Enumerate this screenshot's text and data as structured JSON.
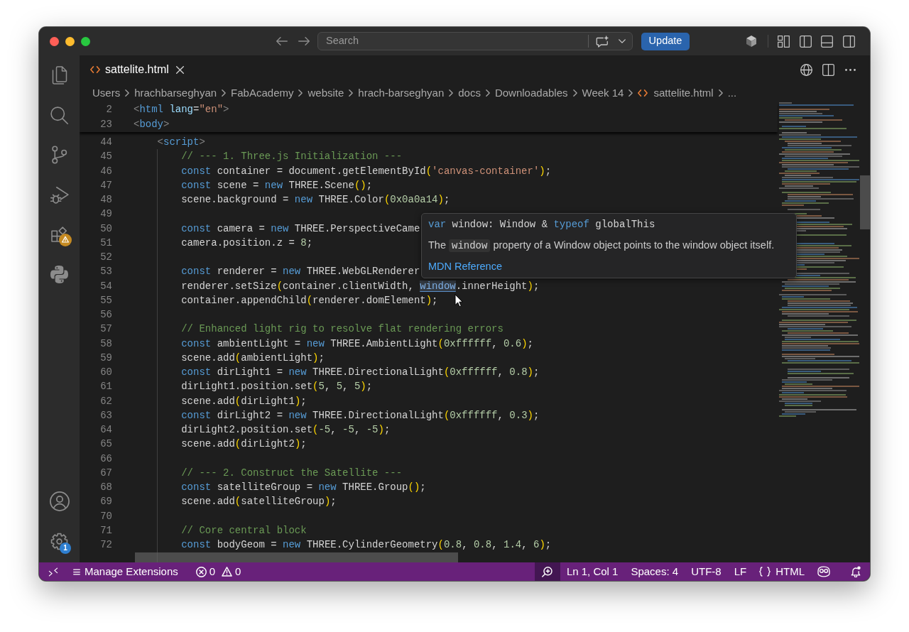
{
  "title_bar": {
    "search": {
      "placeholder": "Search"
    },
    "update_button": {
      "label": "Update"
    }
  },
  "activity_bar": {
    "top": [
      {
        "kind": "explorer"
      },
      {
        "kind": "search"
      },
      {
        "kind": "source_control"
      },
      {
        "kind": "run_debug"
      },
      {
        "kind": "extensions",
        "badge": {
          "kind": "warning"
        }
      },
      {
        "kind": "python"
      }
    ],
    "bottom": [
      {
        "kind": "accounts"
      },
      {
        "kind": "manage",
        "badge": {
          "kind": "count",
          "text": "1"
        }
      }
    ]
  },
  "tabs": [
    {
      "label": "sattelite.html",
      "selected": true
    }
  ],
  "breadcrumbs": [
    {
      "kind": "folder",
      "label": "Users"
    },
    {
      "kind": "folder",
      "label": "hrachbarseghyan"
    },
    {
      "kind": "folder",
      "label": "FabAcademy"
    },
    {
      "kind": "folder",
      "label": "website"
    },
    {
      "kind": "folder",
      "label": "hrach-barseghyan"
    },
    {
      "kind": "folder",
      "label": "docs"
    },
    {
      "kind": "folder",
      "label": "Downloadables"
    },
    {
      "kind": "folder",
      "label": "Week 14"
    },
    {
      "kind": "file",
      "label": "sattelite.html"
    },
    {
      "kind": "more",
      "label": "..."
    }
  ],
  "editor": {
    "sticky_lines": [
      {
        "number": "2",
        "tokens": [
          {
            "kind": "tag_bracket",
            "text": "<"
          },
          {
            "kind": "tag",
            "text": "html"
          },
          {
            "kind": "attribute",
            "text": " lang"
          },
          {
            "kind": "plain",
            "text": "="
          },
          {
            "kind": "string",
            "text": "\"en\""
          },
          {
            "kind": "tag_bracket",
            "text": ">"
          }
        ]
      },
      {
        "number": "23",
        "tokens": [
          {
            "kind": "tag_bracket",
            "text": "<"
          },
          {
            "kind": "tag",
            "text": "body"
          },
          {
            "kind": "tag_bracket",
            "text": ">"
          }
        ]
      }
    ],
    "lines": [
      {
        "number": "44",
        "tokens": [
          {
            "kind": "tag_bracket",
            "text": "    <"
          },
          {
            "kind": "tag",
            "text": "script"
          },
          {
            "kind": "tag_bracket",
            "text": ">"
          }
        ]
      },
      {
        "number": "45",
        "tokens": [
          {
            "kind": "comment",
            "text": "        // --- 1. Three.js Initialization ---"
          }
        ]
      },
      {
        "number": "46",
        "tokens": [
          {
            "kind": "keyword",
            "text": "        const"
          },
          {
            "kind": "plain",
            "text": " container = document.getElementById"
          },
          {
            "kind": "bracket",
            "text": "("
          },
          {
            "kind": "string",
            "text": "'canvas-container'"
          },
          {
            "kind": "bracket",
            "text": ")"
          },
          {
            "kind": "plain",
            "text": ";"
          }
        ]
      },
      {
        "number": "47",
        "tokens": [
          {
            "kind": "keyword",
            "text": "        const"
          },
          {
            "kind": "plain",
            "text": " scene = "
          },
          {
            "kind": "keyword",
            "text": "new"
          },
          {
            "kind": "plain",
            "text": " THREE.Scene"
          },
          {
            "kind": "bracket",
            "text": "()"
          },
          {
            "kind": "plain",
            "text": ";"
          }
        ]
      },
      {
        "number": "48",
        "tokens": [
          {
            "kind": "plain",
            "text": "        scene.background = "
          },
          {
            "kind": "keyword",
            "text": "new"
          },
          {
            "kind": "plain",
            "text": " THREE.Color"
          },
          {
            "kind": "bracket",
            "text": "("
          },
          {
            "kind": "number",
            "text": "0x0a0a14"
          },
          {
            "kind": "bracket",
            "text": ")"
          },
          {
            "kind": "plain",
            "text": ";"
          }
        ]
      },
      {
        "number": "49"
      },
      {
        "number": "50",
        "tokens": [
          {
            "kind": "keyword",
            "text": "        const"
          },
          {
            "kind": "plain",
            "text": " camera = "
          },
          {
            "kind": "keyword",
            "text": "new"
          },
          {
            "kind": "plain",
            "text": " THREE.PerspectiveCame"
          }
        ]
      },
      {
        "number": "51",
        "tokens": [
          {
            "kind": "plain",
            "text": "        camera.position.z = "
          },
          {
            "kind": "number",
            "text": "8"
          },
          {
            "kind": "plain",
            "text": ";"
          }
        ]
      },
      {
        "number": "52"
      },
      {
        "number": "53",
        "tokens": [
          {
            "kind": "keyword",
            "text": "        const"
          },
          {
            "kind": "plain",
            "text": " renderer = "
          },
          {
            "kind": "keyword",
            "text": "new"
          },
          {
            "kind": "plain",
            "text": " THREE.WebGLRenderer"
          }
        ]
      },
      {
        "number": "54",
        "tokens": [
          {
            "kind": "plain",
            "text": "        renderer.setSize"
          },
          {
            "kind": "bracket",
            "text": "("
          },
          {
            "kind": "plain",
            "text": "container.clientWidth, "
          },
          {
            "kind": "hover",
            "text": "window"
          },
          {
            "kind": "plain",
            "text": ".innerHeight"
          },
          {
            "kind": "bracket",
            "text": ")"
          },
          {
            "kind": "plain",
            "text": ";"
          }
        ]
      },
      {
        "number": "55",
        "tokens": [
          {
            "kind": "plain",
            "text": "        container.appendChild"
          },
          {
            "kind": "bracket",
            "text": "("
          },
          {
            "kind": "plain",
            "text": "renderer.domElement"
          },
          {
            "kind": "bracket",
            "text": ")"
          },
          {
            "kind": "plain",
            "text": ";"
          }
        ]
      },
      {
        "number": "56"
      },
      {
        "number": "57",
        "tokens": [
          {
            "kind": "comment",
            "text": "        // Enhanced light rig to resolve flat rendering errors"
          }
        ]
      },
      {
        "number": "58",
        "tokens": [
          {
            "kind": "keyword",
            "text": "        const"
          },
          {
            "kind": "plain",
            "text": " ambientLight = "
          },
          {
            "kind": "keyword",
            "text": "new"
          },
          {
            "kind": "plain",
            "text": " THREE.AmbientLight"
          },
          {
            "kind": "bracket",
            "text": "("
          },
          {
            "kind": "number",
            "text": "0xffffff"
          },
          {
            "kind": "plain",
            "text": ", "
          },
          {
            "kind": "number",
            "text": "0.6"
          },
          {
            "kind": "bracket",
            "text": ")"
          },
          {
            "kind": "plain",
            "text": ";"
          }
        ]
      },
      {
        "number": "59",
        "tokens": [
          {
            "kind": "plain",
            "text": "        scene.add"
          },
          {
            "kind": "bracket",
            "text": "("
          },
          {
            "kind": "plain",
            "text": "ambientLight"
          },
          {
            "kind": "bracket",
            "text": ")"
          },
          {
            "kind": "plain",
            "text": ";"
          }
        ]
      },
      {
        "number": "60",
        "tokens": [
          {
            "kind": "keyword",
            "text": "        const"
          },
          {
            "kind": "plain",
            "text": " dirLight1 = "
          },
          {
            "kind": "keyword",
            "text": "new"
          },
          {
            "kind": "plain",
            "text": " THREE.DirectionalLight"
          },
          {
            "kind": "bracket",
            "text": "("
          },
          {
            "kind": "number",
            "text": "0xffffff"
          },
          {
            "kind": "plain",
            "text": ", "
          },
          {
            "kind": "number",
            "text": "0.8"
          },
          {
            "kind": "bracket",
            "text": ")"
          },
          {
            "kind": "plain",
            "text": ";"
          }
        ]
      },
      {
        "number": "61",
        "tokens": [
          {
            "kind": "plain",
            "text": "        dirLight1.position.set"
          },
          {
            "kind": "bracket",
            "text": "("
          },
          {
            "kind": "number",
            "text": "5"
          },
          {
            "kind": "plain",
            "text": ", "
          },
          {
            "kind": "number",
            "text": "5"
          },
          {
            "kind": "plain",
            "text": ", "
          },
          {
            "kind": "number",
            "text": "5"
          },
          {
            "kind": "bracket",
            "text": ")"
          },
          {
            "kind": "plain",
            "text": ";"
          }
        ]
      },
      {
        "number": "62",
        "tokens": [
          {
            "kind": "plain",
            "text": "        scene.add"
          },
          {
            "kind": "bracket",
            "text": "("
          },
          {
            "kind": "plain",
            "text": "dirLight1"
          },
          {
            "kind": "bracket",
            "text": ")"
          },
          {
            "kind": "plain",
            "text": ";"
          }
        ]
      },
      {
        "number": "63",
        "tokens": [
          {
            "kind": "keyword",
            "text": "        const"
          },
          {
            "kind": "plain",
            "text": " dirLight2 = "
          },
          {
            "kind": "keyword",
            "text": "new"
          },
          {
            "kind": "plain",
            "text": " THREE.DirectionalLight"
          },
          {
            "kind": "bracket",
            "text": "("
          },
          {
            "kind": "number",
            "text": "0xffffff"
          },
          {
            "kind": "plain",
            "text": ", "
          },
          {
            "kind": "number",
            "text": "0.3"
          },
          {
            "kind": "bracket",
            "text": ")"
          },
          {
            "kind": "plain",
            "text": ";"
          }
        ]
      },
      {
        "number": "64",
        "tokens": [
          {
            "kind": "plain",
            "text": "        dirLight2.position.set"
          },
          {
            "kind": "bracket",
            "text": "("
          },
          {
            "kind": "number",
            "text": "-5"
          },
          {
            "kind": "plain",
            "text": ", "
          },
          {
            "kind": "number",
            "text": "-5"
          },
          {
            "kind": "plain",
            "text": ", "
          },
          {
            "kind": "number",
            "text": "-5"
          },
          {
            "kind": "bracket",
            "text": ")"
          },
          {
            "kind": "plain",
            "text": ";"
          }
        ]
      },
      {
        "number": "65",
        "tokens": [
          {
            "kind": "plain",
            "text": "        scene.add"
          },
          {
            "kind": "bracket",
            "text": "("
          },
          {
            "kind": "plain",
            "text": "dirLight2"
          },
          {
            "kind": "bracket",
            "text": ")"
          },
          {
            "kind": "plain",
            "text": ";"
          }
        ]
      },
      {
        "number": "66"
      },
      {
        "number": "67",
        "tokens": [
          {
            "kind": "comment",
            "text": "        // --- 2. Construct the Satellite ---"
          }
        ]
      },
      {
        "number": "68",
        "tokens": [
          {
            "kind": "keyword",
            "text": "        const"
          },
          {
            "kind": "plain",
            "text": " satelliteGroup = "
          },
          {
            "kind": "keyword",
            "text": "new"
          },
          {
            "kind": "plain",
            "text": " THREE.Group"
          },
          {
            "kind": "bracket",
            "text": "()"
          },
          {
            "kind": "plain",
            "text": ";"
          }
        ]
      },
      {
        "number": "69",
        "tokens": [
          {
            "kind": "plain",
            "text": "        scene.add"
          },
          {
            "kind": "bracket",
            "text": "("
          },
          {
            "kind": "plain",
            "text": "satelliteGroup"
          },
          {
            "kind": "bracket",
            "text": ")"
          },
          {
            "kind": "plain",
            "text": ";"
          }
        ]
      },
      {
        "number": "70"
      },
      {
        "number": "71",
        "tokens": [
          {
            "kind": "comment",
            "text": "        // Core central block"
          }
        ]
      },
      {
        "number": "72",
        "tokens": [
          {
            "kind": "keyword",
            "text": "        const"
          },
          {
            "kind": "plain",
            "text": " bodyGeom = "
          },
          {
            "kind": "keyword",
            "text": "new"
          },
          {
            "kind": "plain",
            "text": " THREE.CylinderGeometry"
          },
          {
            "kind": "bracket",
            "text": "("
          },
          {
            "kind": "number",
            "text": "0.8"
          },
          {
            "kind": "plain",
            "text": ", "
          },
          {
            "kind": "number",
            "text": "0.8"
          },
          {
            "kind": "plain",
            "text": ", "
          },
          {
            "kind": "number",
            "text": "1.4"
          },
          {
            "kind": "plain",
            "text": ", "
          },
          {
            "kind": "number",
            "text": "6"
          },
          {
            "kind": "bracket",
            "text": ")"
          },
          {
            "kind": "plain",
            "text": ";"
          }
        ]
      }
    ],
    "hover": {
      "signature": [
        {
          "kind": "keyword",
          "text": "var"
        },
        {
          "kind": "plain",
          "text": " window: Window & "
        },
        {
          "kind": "keyword",
          "text": "typeof"
        },
        {
          "kind": "plain",
          "text": " globalThis"
        }
      ],
      "description": [
        {
          "kind": "text",
          "text": "The "
        },
        {
          "kind": "code",
          "text": "window"
        },
        {
          "kind": "text",
          "text": " property of a Window object points to the window object itself."
        }
      ],
      "link": "MDN Reference"
    }
  },
  "status_bar": {
    "left": [
      {
        "kind": "remote"
      },
      {
        "kind": "manage_extensions",
        "label": "Manage Extensions"
      },
      {
        "kind": "problems",
        "errors": "0",
        "warnings": "0"
      }
    ],
    "right": [
      {
        "kind": "zoom"
      },
      {
        "kind": "text",
        "label": "Ln 1, Col 1"
      },
      {
        "kind": "text",
        "label": "Spaces: 4"
      },
      {
        "kind": "text",
        "label": "UTF-8"
      },
      {
        "kind": "text",
        "label": "LF"
      },
      {
        "kind": "language",
        "label": "HTML"
      },
      {
        "kind": "assistant"
      },
      {
        "kind": "notifications"
      }
    ]
  }
}
